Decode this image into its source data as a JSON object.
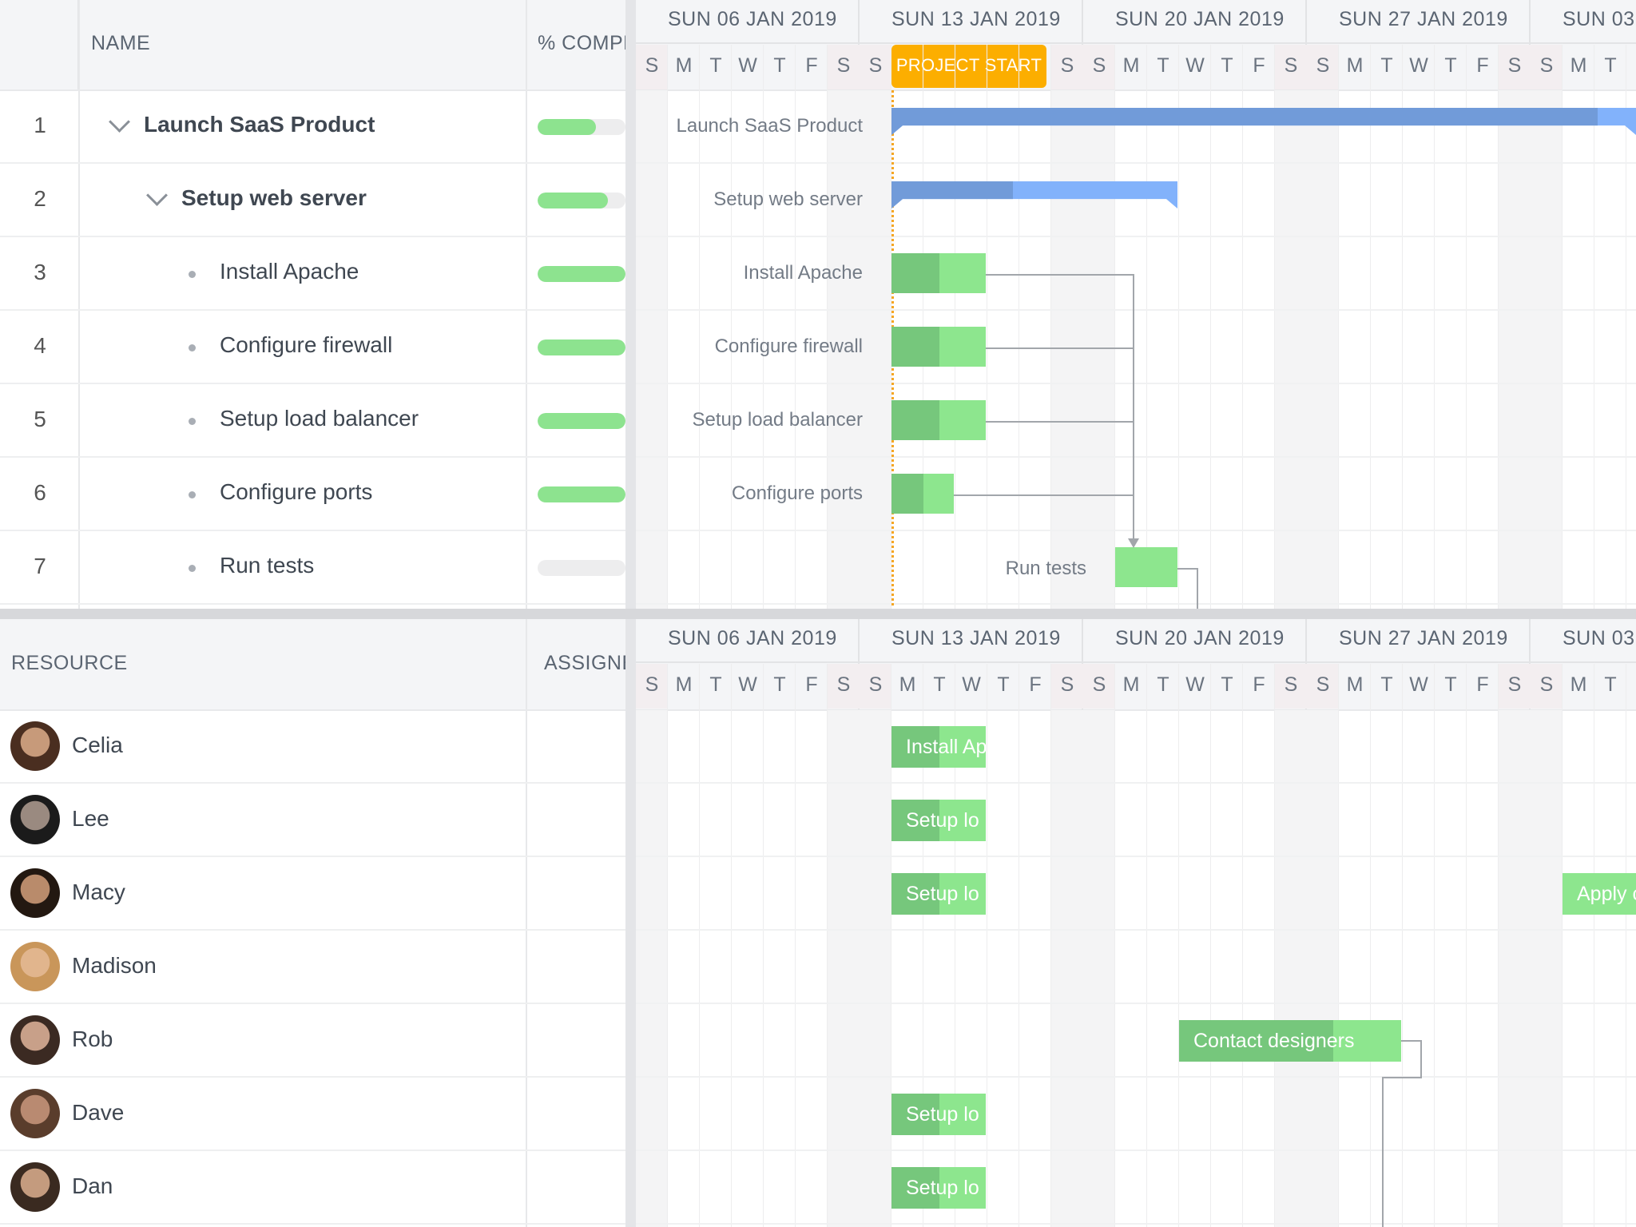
{
  "top": {
    "columns": {
      "name": "NAME",
      "complete": "% COMPL"
    },
    "weeks": [
      "SUN 06 JAN 2019",
      "SUN 13 JAN 2019",
      "SUN 20 JAN 2019",
      "SUN 27 JAN 2019",
      "SUN 03"
    ],
    "days_before": [
      "S",
      "M",
      "T",
      "W",
      "T",
      "F",
      "S",
      "S"
    ],
    "milestone_label": "PROJECT START",
    "days_after": [
      "S",
      "S",
      "M",
      "T",
      "W",
      "T",
      "F",
      "S",
      "S",
      "M",
      "T",
      "W",
      "T",
      "F",
      "S",
      "S",
      "M",
      "T"
    ],
    "tasks": [
      {
        "num": "1",
        "name": "Launch SaaS Product",
        "bar_label": "Launch SaaS Product",
        "percent_complete": 70
      },
      {
        "num": "2",
        "name": "Setup web server",
        "bar_label": "Setup web server",
        "percent_complete": 80
      },
      {
        "num": "3",
        "name": "Install Apache",
        "bar_label": "Install Apache",
        "percent_complete": 100
      },
      {
        "num": "4",
        "name": "Configure firewall",
        "bar_label": "Configure firewall",
        "percent_complete": 100
      },
      {
        "num": "5",
        "name": "Setup load balancer",
        "bar_label": "Setup load balancer",
        "percent_complete": 100
      },
      {
        "num": "6",
        "name": "Configure ports",
        "bar_label": "Configure ports",
        "percent_complete": 100
      },
      {
        "num": "7",
        "name": "Run tests",
        "bar_label": "Run tests",
        "percent_complete": 0
      }
    ]
  },
  "bottom": {
    "columns": {
      "resource": "RESOURCE",
      "assigned": "ASSIGNE"
    },
    "weeks": [
      "SUN 06 JAN 2019",
      "SUN 13 JAN 2019",
      "SUN 20 JAN 2019",
      "SUN 27 JAN 2019",
      "SUN 03"
    ],
    "days": [
      "S",
      "M",
      "T",
      "W",
      "T",
      "F",
      "S",
      "S",
      "M",
      "T",
      "W",
      "T",
      "F",
      "S",
      "S",
      "M",
      "T",
      "W",
      "T",
      "F",
      "S",
      "S",
      "M",
      "T",
      "W",
      "T",
      "F",
      "S",
      "S",
      "M",
      "T"
    ],
    "resources": [
      {
        "name": "Celia"
      },
      {
        "name": "Lee"
      },
      {
        "name": "Macy"
      },
      {
        "name": "Madison"
      },
      {
        "name": "Rob"
      },
      {
        "name": "Dave"
      },
      {
        "name": "Dan"
      }
    ],
    "bars": [
      {
        "label": "Install Ap"
      },
      {
        "label": "Setup lo"
      },
      {
        "label": "Setup lo"
      },
      {
        "label": "Apply c"
      },
      {
        "label": "Contact designers"
      },
      {
        "label": "Setup lo"
      },
      {
        "label": "Setup lo"
      }
    ]
  },
  "colors": {
    "milestone": "#fcae00",
    "progress": "#8de38f",
    "task_bar": "#8de68e",
    "task_bar_done": "#76c77c",
    "parent_bar": "#82b2fb",
    "parent_bar_done": "#719bd9"
  }
}
